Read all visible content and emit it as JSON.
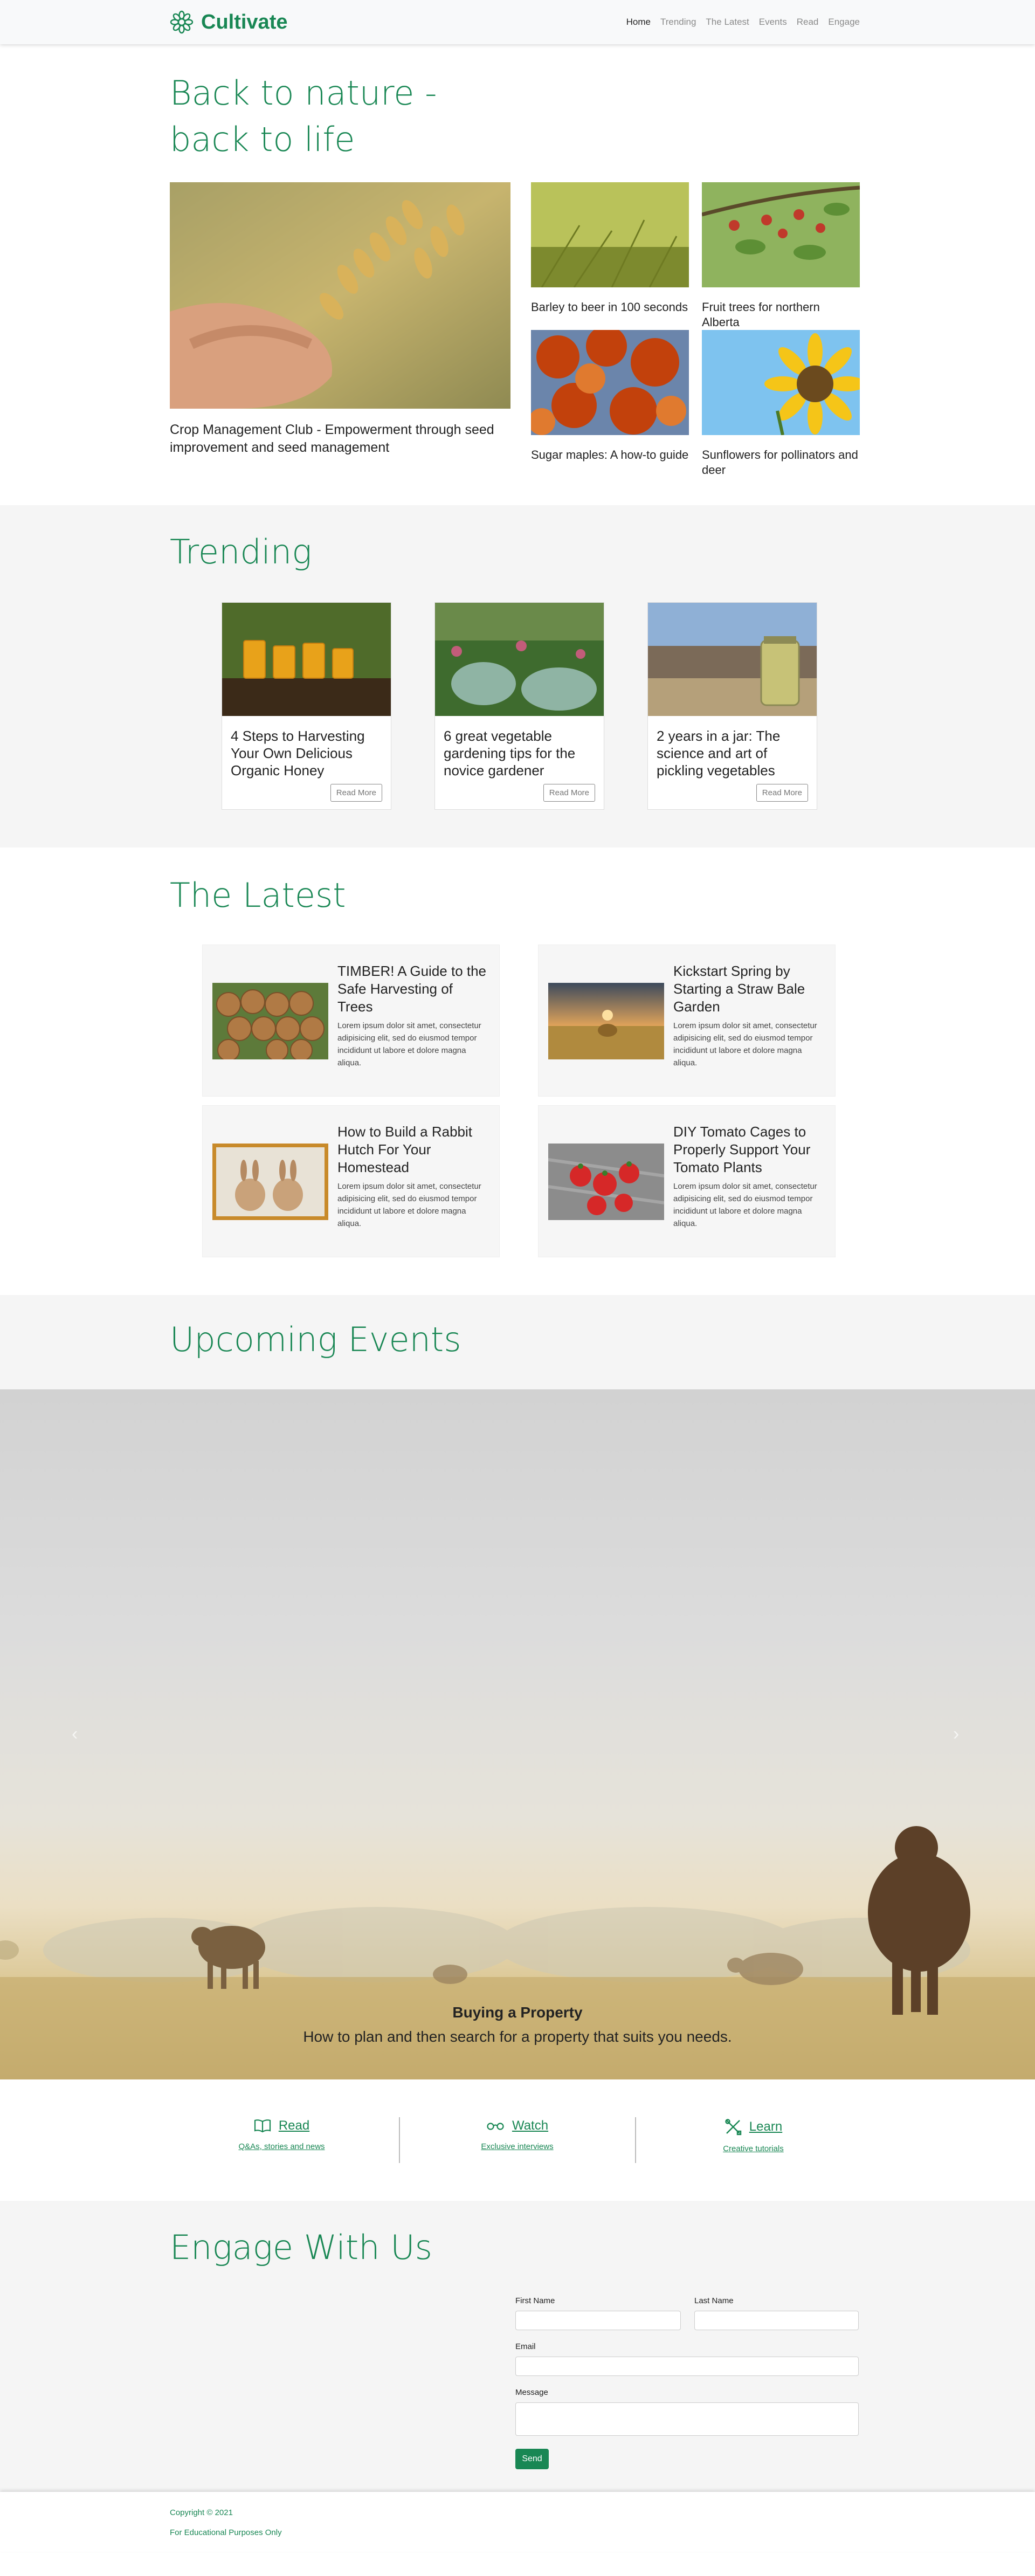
{
  "nav": {
    "brand": "Cultivate",
    "links": [
      "Home",
      "Trending",
      "The Latest",
      "Events",
      "Read",
      "Engage"
    ]
  },
  "hero": {
    "title": "Back to nature - back to life",
    "main_caption": "Crop Management Club - Empowerment through seed improvement and seed management",
    "items": [
      {
        "caption": "Barley to beer in 100 seconds"
      },
      {
        "caption": "Fruit trees for northern Alberta"
      },
      {
        "caption": "Sugar maples: A how-to guide"
      },
      {
        "caption": "Sunflowers for pollinators and deer"
      }
    ]
  },
  "trending": {
    "title": "Trending",
    "cards": [
      {
        "title": "4 Steps to Harvesting Your Own Delicious Organic Honey",
        "button": "Read More"
      },
      {
        "title": "6 great vegetable gardening tips for the novice gardener",
        "button": "Read More"
      },
      {
        "title": "2 years in a jar: The science and art of pickling vegetables",
        "button": "Read More"
      }
    ]
  },
  "latest": {
    "title": "The Latest",
    "cards": [
      {
        "title": "TIMBER! A Guide to the Safe Harvesting of Trees",
        "body": "Lorem ipsum dolor sit amet, consectetur adipisicing elit, sed do eiusmod tempor incididunt ut labore et dolore magna aliqua."
      },
      {
        "title": "Kickstart Spring by Starting a Straw Bale Garden",
        "body": "Lorem ipsum dolor sit amet, consectetur adipisicing elit, sed do eiusmod tempor incididunt ut labore et dolore magna aliqua."
      },
      {
        "title": "How to Build a Rabbit Hutch For Your Homestead",
        "body": "Lorem ipsum dolor sit amet, consectetur adipisicing elit, sed do eiusmod tempor incididunt ut labore et dolore magna aliqua."
      },
      {
        "title": "DIY Tomato Cages to Properly Support Your Tomato Plants",
        "body": "Lorem ipsum dolor sit amet, consectetur adipisicing elit, sed do eiusmod tempor incididunt ut labore et dolore magna aliqua."
      }
    ]
  },
  "events": {
    "title": "Upcoming Events",
    "slide_title": "Buying a Property",
    "slide_subtitle": "How to plan and then search for a property that suits you needs.",
    "prev_icon": "‹",
    "next_icon": "›"
  },
  "links": [
    {
      "label": "Read",
      "sub": "Q&As, stories and news",
      "icon": "book-icon"
    },
    {
      "label": "Watch",
      "sub": "Exclusive interviews",
      "icon": "glasses-icon"
    },
    {
      "label": "Learn",
      "sub": "Creative tutorials",
      "icon": "tools-icon"
    }
  ],
  "engage": {
    "title": "Engage With Us",
    "first_name_label": "First Name",
    "last_name_label": "Last Name",
    "email_label": "Email",
    "message_label": "Message",
    "send_label": "Send"
  },
  "footer": {
    "copyright": "Copyright © 2021",
    "note": "For Educational Purposes Only"
  },
  "colors": {
    "accent": "#198754",
    "section_bg": "#f5f5f5"
  }
}
